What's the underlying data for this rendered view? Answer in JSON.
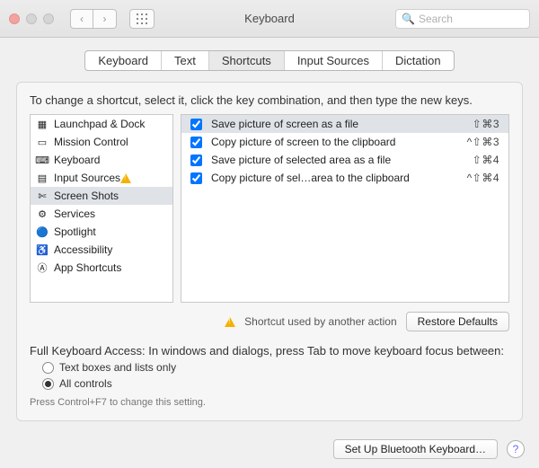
{
  "window": {
    "title": "Keyboard"
  },
  "search": {
    "placeholder": "Search"
  },
  "tabs": [
    {
      "label": "Keyboard"
    },
    {
      "label": "Text"
    },
    {
      "label": "Shortcuts",
      "active": true
    },
    {
      "label": "Input Sources"
    },
    {
      "label": "Dictation"
    }
  ],
  "instruction": "To change a shortcut, select it, click the key combination, and then type the new keys.",
  "sidebar": {
    "items": [
      {
        "label": "Launchpad & Dock",
        "icon": "launchpad"
      },
      {
        "label": "Mission Control",
        "icon": "mission-control"
      },
      {
        "label": "Keyboard",
        "icon": "keyboard"
      },
      {
        "label": "Input Sources",
        "icon": "input-sources",
        "warning": true
      },
      {
        "label": "Screen Shots",
        "icon": "screenshots",
        "selected": true
      },
      {
        "label": "Services",
        "icon": "services"
      },
      {
        "label": "Spotlight",
        "icon": "spotlight"
      },
      {
        "label": "Accessibility",
        "icon": "accessibility"
      },
      {
        "label": "App Shortcuts",
        "icon": "app-shortcuts"
      }
    ]
  },
  "shortcuts": [
    {
      "checked": true,
      "desc": "Save picture of screen as a file",
      "keys": "⇧⌘3",
      "selected": true
    },
    {
      "checked": true,
      "desc": "Copy picture of screen to the clipboard",
      "keys": "^⇧⌘3"
    },
    {
      "checked": true,
      "desc": "Save picture of selected area as a file",
      "keys": "⇧⌘4"
    },
    {
      "checked": true,
      "desc": "Copy picture of sel…area to the clipboard",
      "keys": "^⇧⌘4"
    }
  ],
  "legend": {
    "warning_text": "Shortcut used by another action"
  },
  "buttons": {
    "restore": "Restore Defaults",
    "bluetooth": "Set Up Bluetooth Keyboard…"
  },
  "fka": {
    "label": "Full Keyboard Access: In windows and dialogs, press Tab to move keyboard focus between:",
    "opt1": "Text boxes and lists only",
    "opt2": "All controls",
    "selected": "opt2",
    "hint": "Press Control+F7 to change this setting."
  }
}
